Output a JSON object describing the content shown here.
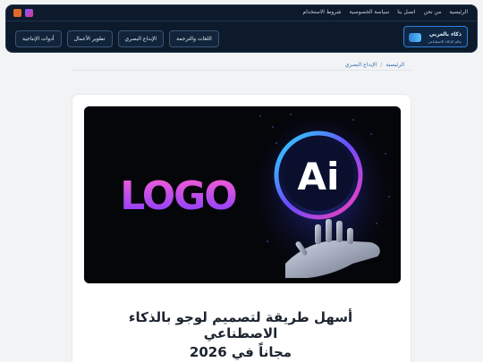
{
  "topbar": {
    "links": [
      "الرئيسية",
      "من نحن",
      "اتصل بنا",
      "سياسة الخصوصية",
      "شروط الاستخدام"
    ],
    "social": [
      "instagram-icon",
      "facebook-icon"
    ]
  },
  "brand": {
    "name": "ذكاء بالعربي",
    "tagline": "عالم الذكاء الاصطناعي"
  },
  "nav": {
    "items": [
      "اللغات والترجمة",
      "الإبداع البصري",
      "تطوير الأعمال",
      "أدوات الإنتاجية"
    ]
  },
  "breadcrumb": {
    "home": "الرئيسية",
    "separator": "/",
    "current": "الإبداع البصري"
  },
  "article": {
    "hero_logo_text": "LOGO",
    "hero_ai_text": "Ai",
    "title_line1": "أسهل طريقة لتصميم لوجو بالذكاء الاصطناعي",
    "title_line2": "مجاناً في 2026"
  },
  "colors": {
    "header_bg": "#0d1a2b",
    "accent": "#2d7fd6",
    "page_bg": "#f2f3f5"
  }
}
